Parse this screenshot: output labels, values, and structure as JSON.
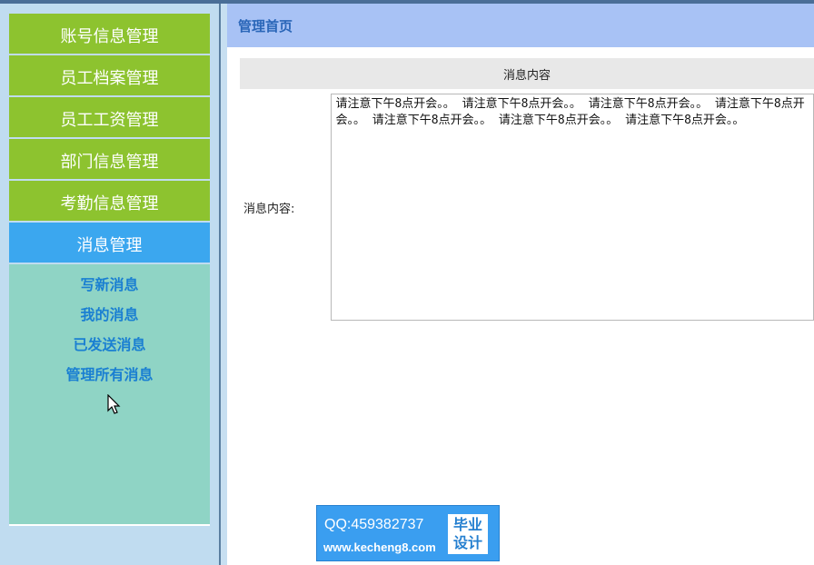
{
  "sidebar": {
    "menu": [
      {
        "label": "账号信息管理"
      },
      {
        "label": "员工档案管理"
      },
      {
        "label": "员工工资管理"
      },
      {
        "label": "部门信息管理"
      },
      {
        "label": "考勤信息管理"
      },
      {
        "label": "消息管理"
      }
    ],
    "submenu": [
      {
        "label": "写新消息"
      },
      {
        "label": "我的消息"
      },
      {
        "label": "已发送消息"
      },
      {
        "label": "管理所有消息"
      }
    ]
  },
  "header": {
    "title": "管理首页"
  },
  "form": {
    "table_header": "消息内容",
    "field_label": "消息内容:",
    "field_value": "请注意下午8点开会。。 请注意下午8点开会。。 请注意下午8点开会。。 请注意下午8点开会。。 请注意下午8点开会。。 请注意下午8点开会。。 请注意下午8点开会。。"
  },
  "watermark": {
    "qq": "QQ:459382737",
    "url": "www.kecheng8.com",
    "box_line1": "毕业",
    "box_line2": "设计"
  },
  "colors": {
    "menu_green": "#8dc32f",
    "menu_active_blue": "#3ba7ef",
    "submenu_bg": "#8fd4c5",
    "header_bg": "#a8c2f5"
  }
}
